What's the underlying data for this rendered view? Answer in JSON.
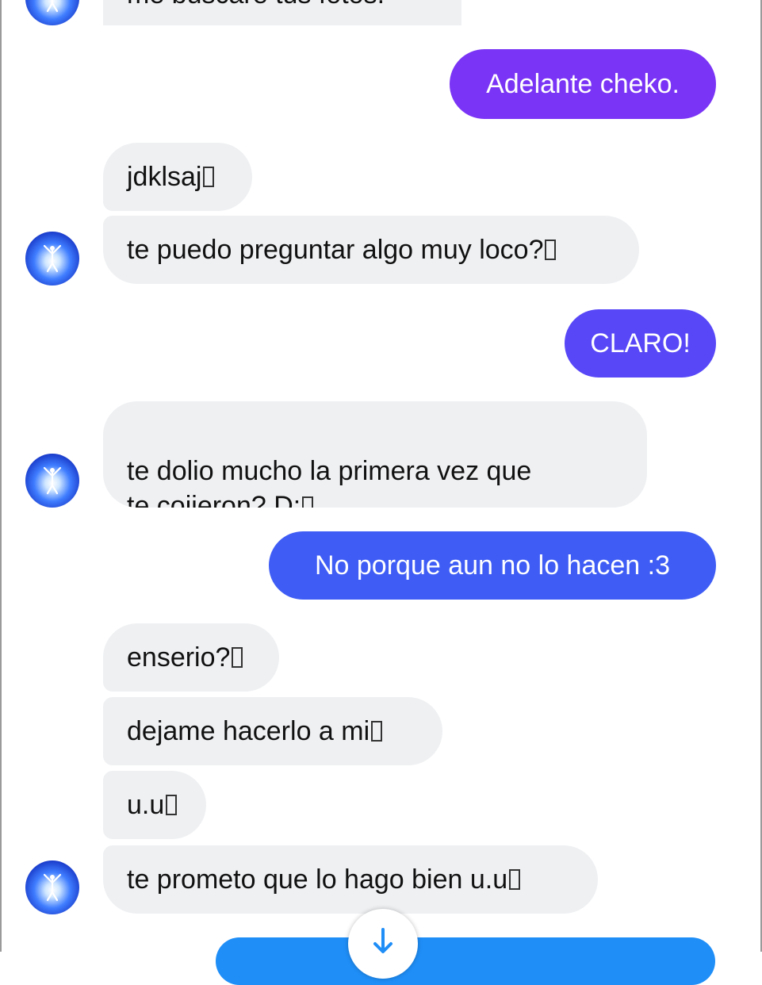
{
  "conversation": {
    "messages": [
      {
        "id": "m0",
        "side": "in",
        "text": "me buscaré tus fotos."
      },
      {
        "id": "m1",
        "side": "out",
        "text": "Adelante cheko."
      },
      {
        "id": "m2",
        "side": "in",
        "text": "jdklsaj"
      },
      {
        "id": "m3",
        "side": "in",
        "text": "te puedo preguntar algo muy loco?"
      },
      {
        "id": "m4",
        "side": "out",
        "text": "CLARO!"
      },
      {
        "id": "m5",
        "side": "in",
        "text": "te dolio mucho la primera vez que\nte cojieron? D:"
      },
      {
        "id": "m6",
        "side": "out",
        "text": "No porque aun no lo hacen :3"
      },
      {
        "id": "m7",
        "side": "in",
        "text": "enserio?"
      },
      {
        "id": "m8",
        "side": "in",
        "text": "dejame hacerlo a mi"
      },
      {
        "id": "m9",
        "side": "in",
        "text": "u.u"
      },
      {
        "id": "m10",
        "side": "in",
        "text": "te prometo que lo hago bien u.u"
      }
    ]
  },
  "colors": {
    "incoming_bubble": "#eef0f2",
    "outgoing_purple": "#7a34f5",
    "outgoing_indigo": "#5747f7",
    "outgoing_blue": "#3f5df5",
    "compose_bar": "#1f8ef7",
    "scroll_arrow": "#1f8ef7"
  },
  "icons": {
    "scroll_down": "arrow-down-icon",
    "avatar": "contact-avatar"
  }
}
